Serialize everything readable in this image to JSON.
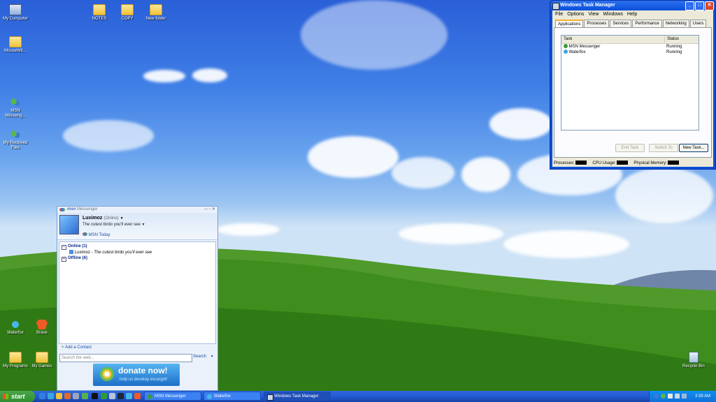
{
  "desktop": {
    "icons_left": [
      {
        "label": "My Computer"
      },
      {
        "label": "MouseWit..."
      },
      {
        "label": "MSN Messeng..."
      },
      {
        "label": "My Received Files"
      },
      {
        "label": "Waterfox"
      },
      {
        "label": "Brave"
      },
      {
        "label": "My Programs"
      },
      {
        "label": "My Games"
      }
    ],
    "icons_top": [
      {
        "label": "NOTES"
      },
      {
        "label": "COPY"
      },
      {
        "label": "New folder"
      }
    ],
    "recycle_bin": "Recycle Bin"
  },
  "task_manager": {
    "title": "Windows Task Manager",
    "menu": [
      "File",
      "Options",
      "View",
      "Windows",
      "Help"
    ],
    "tabs": [
      "Applications",
      "Processes",
      "Services",
      "Performance",
      "Networking",
      "Users"
    ],
    "columns": [
      "Task",
      "Status"
    ],
    "rows": [
      {
        "task": "MSN Messenger",
        "status": "Running"
      },
      {
        "task": "Waterfox",
        "status": "Running"
      }
    ],
    "buttons": {
      "end_task": "End Task",
      "switch_to": "Switch To",
      "new_task": "New Task..."
    },
    "status": {
      "processes": "Processes:",
      "cpu": "CPU Usage:",
      "memory": "Physical Memory:"
    }
  },
  "messenger": {
    "title_brand": "msn",
    "title": "Messenger",
    "user": "Luximoz",
    "presence": "(Online)",
    "personal_message": "The cutest birdo you'll ever see",
    "msn_today": "MSN Today",
    "groups": [
      {
        "label": "Online (1)"
      },
      {
        "label": "Offline (6)"
      }
    ],
    "contact": {
      "name": "Luximoz",
      "sep": " - ",
      "message": "The cutest birdo you'll ever see"
    },
    "add_contact": "Add a Contact",
    "search_placeholder": "Search the web...",
    "search_button": "Search",
    "donate_title": "donate now!",
    "donate_sub": "help us develop escargot!"
  },
  "taskbar": {
    "start": "start",
    "tasks": [
      {
        "label": "MSN Messenger"
      },
      {
        "label": "Waterfox"
      },
      {
        "label": "Windows Task Manager"
      }
    ],
    "clock": "3:39 AM"
  }
}
